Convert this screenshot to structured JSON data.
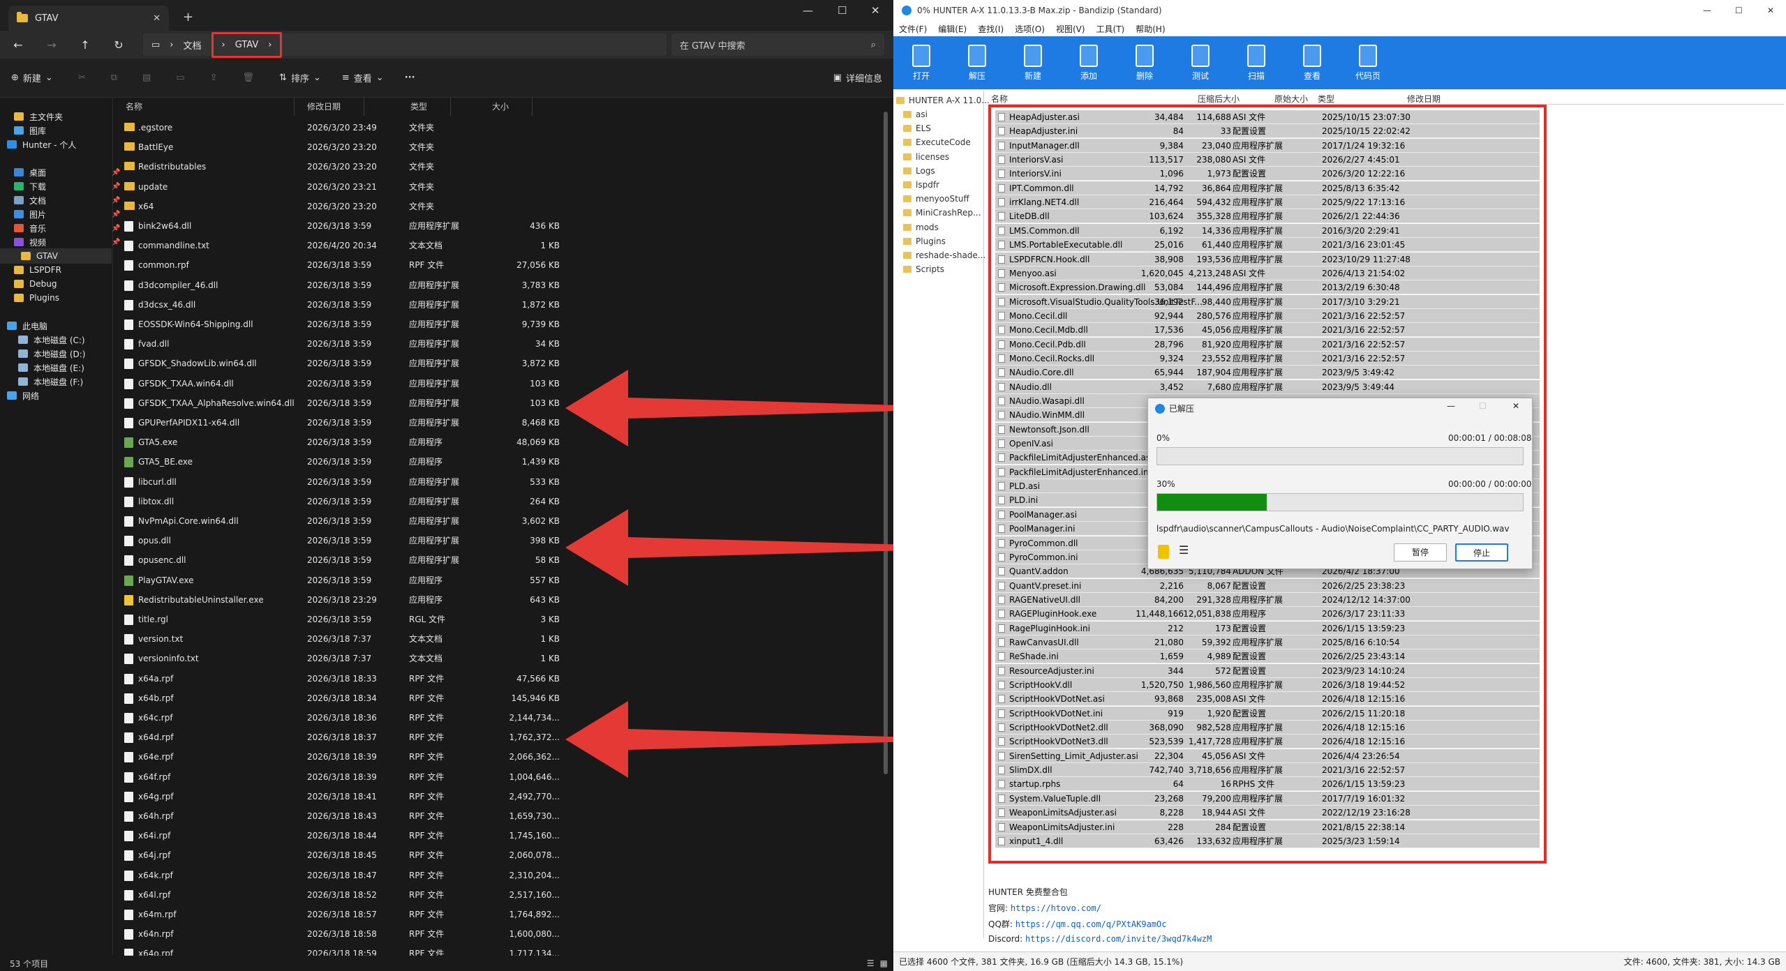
{
  "explorer": {
    "tab_title": "GTAV",
    "path": [
      "文档",
      "GTAV"
    ],
    "search_placeholder": "在 GTAV 中搜索",
    "toolbar": {
      "new": "新建",
      "sort": "排序",
      "view": "查看",
      "more": "···",
      "details": "详细信息"
    },
    "columns": {
      "name": "名称",
      "date": "修改日期",
      "type": "类型",
      "size": "大小"
    },
    "sidebar": [
      {
        "label": "主文件夹",
        "icon": "home-icon",
        "color": "#e8b93a"
      },
      {
        "label": "图库",
        "icon": "gallery-icon",
        "color": "#4aa3e8"
      },
      {
        "label": "Hunter - 个人",
        "icon": "cloud-icon",
        "color": "#2d8fe5"
      },
      {
        "label": "桌面",
        "icon": "desktop-icon",
        "color": "#3d86d6"
      },
      {
        "label": "下载",
        "icon": "download-icon",
        "color": "#2db36d"
      },
      {
        "label": "文档",
        "icon": "documents-icon",
        "color": "#7ea0c4"
      },
      {
        "label": "图片",
        "icon": "pictures-icon",
        "color": "#3c8fe0"
      },
      {
        "label": "音乐",
        "icon": "music-icon",
        "color": "#e2553e"
      },
      {
        "label": "视频",
        "icon": "videos-icon",
        "color": "#8a53d6"
      },
      {
        "label": "GTAV",
        "icon": "folder-icon",
        "color": "#e8b93a"
      },
      {
        "label": "LSPDFR",
        "icon": "folder-icon",
        "color": "#e8b93a"
      },
      {
        "label": "Debug",
        "icon": "folder-icon",
        "color": "#e8b93a"
      },
      {
        "label": "Plugins",
        "icon": "folder-icon",
        "color": "#e8b93a"
      },
      {
        "label": "此电脑",
        "icon": "pc-icon",
        "color": "#4aa3e8"
      },
      {
        "label": "本地磁盘 (C:)",
        "icon": "drive-icon",
        "color": "#8fb4d8"
      },
      {
        "label": "本地磁盘 (D:)",
        "icon": "drive-icon",
        "color": "#8fb4d8"
      },
      {
        "label": "本地磁盘 (E:)",
        "icon": "drive-icon",
        "color": "#8fb4d8"
      },
      {
        "label": "本地磁盘 (F:)",
        "icon": "drive-icon",
        "color": "#8fb4d8"
      },
      {
        "label": "网络",
        "icon": "network-icon",
        "color": "#4aa3e8"
      }
    ],
    "files": [
      {
        "name": ".egstore",
        "date": "2026/3/20 23:49",
        "type": "文件夹",
        "size": "",
        "kind": "folder"
      },
      {
        "name": "BattlEye",
        "date": "2026/3/20 23:20",
        "type": "文件夹",
        "size": "",
        "kind": "folder"
      },
      {
        "name": "Redistributables",
        "date": "2026/3/20 23:20",
        "type": "文件夹",
        "size": "",
        "kind": "folder"
      },
      {
        "name": "update",
        "date": "2026/3/20 23:21",
        "type": "文件夹",
        "size": "",
        "kind": "folder"
      },
      {
        "name": "x64",
        "date": "2026/3/20 23:20",
        "type": "文件夹",
        "size": "",
        "kind": "folder"
      },
      {
        "name": "bink2w64.dll",
        "date": "2026/3/18 3:59",
        "type": "应用程序扩展",
        "size": "436 KB",
        "kind": "file"
      },
      {
        "name": "commandline.txt",
        "date": "2026/4/20 20:34",
        "type": "文本文档",
        "size": "1 KB",
        "kind": "file"
      },
      {
        "name": "common.rpf",
        "date": "2026/3/18 3:59",
        "type": "RPF 文件",
        "size": "27,056 KB",
        "kind": "file"
      },
      {
        "name": "d3dcompiler_46.dll",
        "date": "2026/3/18 3:59",
        "type": "应用程序扩展",
        "size": "3,783 KB",
        "kind": "file"
      },
      {
        "name": "d3dcsx_46.dll",
        "date": "2026/3/18 3:59",
        "type": "应用程序扩展",
        "size": "1,872 KB",
        "kind": "file"
      },
      {
        "name": "EOSSDK-Win64-Shipping.dll",
        "date": "2026/3/18 3:59",
        "type": "应用程序扩展",
        "size": "9,739 KB",
        "kind": "file"
      },
      {
        "name": "fvad.dll",
        "date": "2026/3/18 3:59",
        "type": "应用程序扩展",
        "size": "34 KB",
        "kind": "file"
      },
      {
        "name": "GFSDK_ShadowLib.win64.dll",
        "date": "2026/3/18 3:59",
        "type": "应用程序扩展",
        "size": "3,872 KB",
        "kind": "file"
      },
      {
        "name": "GFSDK_TXAA.win64.dll",
        "date": "2026/3/18 3:59",
        "type": "应用程序扩展",
        "size": "103 KB",
        "kind": "file"
      },
      {
        "name": "GFSDK_TXAA_AlphaResolve.win64.dll",
        "date": "2026/3/18 3:59",
        "type": "应用程序扩展",
        "size": "103 KB",
        "kind": "file"
      },
      {
        "name": "GPUPerfAPIDX11-x64.dll",
        "date": "2026/3/18 3:59",
        "type": "应用程序扩展",
        "size": "8,468 KB",
        "kind": "file"
      },
      {
        "name": "GTA5.exe",
        "date": "2026/3/18 3:59",
        "type": "应用程序",
        "size": "48,069 KB",
        "kind": "exe"
      },
      {
        "name": "GTA5_BE.exe",
        "date": "2026/3/18 3:59",
        "type": "应用程序",
        "size": "1,439 KB",
        "kind": "exe"
      },
      {
        "name": "libcurl.dll",
        "date": "2026/3/18 3:59",
        "type": "应用程序扩展",
        "size": "533 KB",
        "kind": "file"
      },
      {
        "name": "libtox.dll",
        "date": "2026/3/18 3:59",
        "type": "应用程序扩展",
        "size": "264 KB",
        "kind": "file"
      },
      {
        "name": "NvPmApi.Core.win64.dll",
        "date": "2026/3/18 3:59",
        "type": "应用程序扩展",
        "size": "3,602 KB",
        "kind": "file"
      },
      {
        "name": "opus.dll",
        "date": "2026/3/18 3:59",
        "type": "应用程序扩展",
        "size": "398 KB",
        "kind": "file"
      },
      {
        "name": "opusenc.dll",
        "date": "2026/3/18 3:59",
        "type": "应用程序扩展",
        "size": "58 KB",
        "kind": "file"
      },
      {
        "name": "PlayGTAV.exe",
        "date": "2026/3/18 3:59",
        "type": "应用程序",
        "size": "557 KB",
        "kind": "exe"
      },
      {
        "name": "RedistributableUninstaller.exe",
        "date": "2026/3/18 23:29",
        "type": "应用程序",
        "size": "643 KB",
        "kind": "exe2"
      },
      {
        "name": "title.rgl",
        "date": "2026/3/18 3:59",
        "type": "RGL 文件",
        "size": "3 KB",
        "kind": "file"
      },
      {
        "name": "version.txt",
        "date": "2026/3/18 7:37",
        "type": "文本文档",
        "size": "1 KB",
        "kind": "file"
      },
      {
        "name": "versioninfo.txt",
        "date": "2026/3/18 7:37",
        "type": "文本文档",
        "size": "1 KB",
        "kind": "file"
      },
      {
        "name": "x64a.rpf",
        "date": "2026/3/18 18:33",
        "type": "RPF 文件",
        "size": "47,566 KB",
        "kind": "file"
      },
      {
        "name": "x64b.rpf",
        "date": "2026/3/18 18:34",
        "type": "RPF 文件",
        "size": "145,946 KB",
        "kind": "file"
      },
      {
        "name": "x64c.rpf",
        "date": "2026/3/18 18:36",
        "type": "RPF 文件",
        "size": "2,144,734...",
        "kind": "file"
      },
      {
        "name": "x64d.rpf",
        "date": "2026/3/18 18:37",
        "type": "RPF 文件",
        "size": "1,762,372...",
        "kind": "file"
      },
      {
        "name": "x64e.rpf",
        "date": "2026/3/18 18:39",
        "type": "RPF 文件",
        "size": "2,066,362...",
        "kind": "file"
      },
      {
        "name": "x64f.rpf",
        "date": "2026/3/18 18:39",
        "type": "RPF 文件",
        "size": "1,004,646...",
        "kind": "file"
      },
      {
        "name": "x64g.rpf",
        "date": "2026/3/18 18:41",
        "type": "RPF 文件",
        "size": "2,492,770...",
        "kind": "file"
      },
      {
        "name": "x64h.rpf",
        "date": "2026/3/18 18:43",
        "type": "RPF 文件",
        "size": "1,659,730...",
        "kind": "file"
      },
      {
        "name": "x64i.rpf",
        "date": "2026/3/18 18:44",
        "type": "RPF 文件",
        "size": "1,745,160...",
        "kind": "file"
      },
      {
        "name": "x64j.rpf",
        "date": "2026/3/18 18:45",
        "type": "RPF 文件",
        "size": "2,060,078...",
        "kind": "file"
      },
      {
        "name": "x64k.rpf",
        "date": "2026/3/18 18:47",
        "type": "RPF 文件",
        "size": "2,310,204...",
        "kind": "file"
      },
      {
        "name": "x64l.rpf",
        "date": "2026/3/18 18:52",
        "type": "RPF 文件",
        "size": "2,517,160...",
        "kind": "file"
      },
      {
        "name": "x64m.rpf",
        "date": "2026/3/18 18:57",
        "type": "RPF 文件",
        "size": "1,764,892...",
        "kind": "file"
      },
      {
        "name": "x64n.rpf",
        "date": "2026/3/18 18:58",
        "type": "RPF 文件",
        "size": "1,600,080...",
        "kind": "file"
      },
      {
        "name": "x64o.rpf",
        "date": "2026/3/18 18:59",
        "type": "RPF 文件",
        "size": "1,717,134...",
        "kind": "file"
      }
    ],
    "status": "53 个项目"
  },
  "bandizip": {
    "title": "0% HUNTER A-X 11.0.13.3-B Max.zip - Bandizip (Standard)",
    "menu": [
      "文件(F)",
      "编辑(E)",
      "查找(I)",
      "选项(O)",
      "视图(V)",
      "工具(T)",
      "帮助(H)"
    ],
    "toolbar": [
      {
        "label": "打开",
        "icon": "open-icon"
      },
      {
        "label": "解压",
        "icon": "extract-icon"
      },
      {
        "label": "新建",
        "icon": "new-archive-icon"
      },
      {
        "label": "添加",
        "icon": "add-icon"
      },
      {
        "label": "删除",
        "icon": "delete-icon"
      },
      {
        "label": "测试",
        "icon": "test-icon"
      },
      {
        "label": "扫描",
        "icon": "scan-icon"
      },
      {
        "label": "查看",
        "icon": "view-icon"
      },
      {
        "label": "代码页",
        "icon": "codepage-icon"
      }
    ],
    "tree_root": "HUNTER A-X 11.0...",
    "tree": [
      "asi",
      "ELS",
      "ExecuteCode",
      "licenses",
      "Logs",
      "lspdfr",
      "menyooStuff",
      "MiniCrashRep...",
      "mods",
      "Plugins",
      "reshade-shade...",
      "Scripts"
    ],
    "columns": {
      "name": "名称",
      "packed": "压缩后大小",
      "original": "原始大小",
      "type": "类型",
      "date": "修改日期"
    },
    "files": [
      [
        "HeapAdjuster.asi",
        "34,484",
        "114,688",
        "ASI 文件",
        "2025/10/15 23:07:30"
      ],
      [
        "HeapAdjuster.ini",
        "84",
        "33",
        "配置设置",
        "2025/10/15 22:02:42"
      ],
      [
        "InputManager.dll",
        "9,384",
        "23,040",
        "应用程序扩展",
        "2017/1/24 19:32:16"
      ],
      [
        "InteriorsV.asi",
        "113,517",
        "238,080",
        "ASI 文件",
        "2026/2/27 4:45:01"
      ],
      [
        "InteriorsV.ini",
        "1,096",
        "1,973",
        "配置设置",
        "2026/3/20 12:22:16"
      ],
      [
        "IPT.Common.dll",
        "14,792",
        "36,864",
        "应用程序扩展",
        "2025/8/13 6:35:42"
      ],
      [
        "irrKlang.NET4.dll",
        "216,464",
        "594,432",
        "应用程序扩展",
        "2025/9/22 17:13:16"
      ],
      [
        "LiteDB.dll",
        "103,624",
        "355,328",
        "应用程序扩展",
        "2026/2/1 22:44:36"
      ],
      [
        "LMS.Common.dll",
        "6,192",
        "14,336",
        "应用程序扩展",
        "2016/3/20 2:29:41"
      ],
      [
        "LMS.PortableExecutable.dll",
        "25,016",
        "61,440",
        "应用程序扩展",
        "2021/3/16 23:01:45"
      ],
      [
        "LSPDFRCN.Hook.dll",
        "38,908",
        "193,536",
        "应用程序扩展",
        "2023/10/29 11:27:48"
      ],
      [
        "Menyoo.asi",
        "1,620,045",
        "4,213,248",
        "ASI 文件",
        "2026/4/13 21:54:02"
      ],
      [
        "Microsoft.Expression.Drawing.dll",
        "53,084",
        "144,496",
        "应用程序扩展",
        "2013/2/19 6:30:48"
      ],
      [
        "Microsoft.VisualStudio.QualityTools.UnitTestF...",
        "36,192",
        "98,440",
        "应用程序扩展",
        "2017/3/10 3:29:21"
      ],
      [
        "Mono.Cecil.dll",
        "92,944",
        "280,576",
        "应用程序扩展",
        "2021/3/16 22:52:57"
      ],
      [
        "Mono.Cecil.Mdb.dll",
        "17,536",
        "45,056",
        "应用程序扩展",
        "2021/3/16 22:52:57"
      ],
      [
        "Mono.Cecil.Pdb.dll",
        "28,796",
        "81,920",
        "应用程序扩展",
        "2021/3/16 22:52:57"
      ],
      [
        "Mono.Cecil.Rocks.dll",
        "9,324",
        "23,552",
        "应用程序扩展",
        "2021/3/16 22:52:57"
      ],
      [
        "NAudio.Core.dll",
        "65,944",
        "187,904",
        "应用程序扩展",
        "2023/9/5 3:49:42"
      ],
      [
        "NAudio.dll",
        "3,452",
        "7,680",
        "应用程序扩展",
        "2023/9/5 3:49:44"
      ],
      [
        "NAudio.Wasapi.dll",
        "",
        "",
        "",
        ""
      ],
      [
        "NAudio.WinMM.dll",
        "",
        "",
        "",
        ""
      ],
      [
        "Newtonsoft.Json.dll",
        "",
        "",
        "",
        ""
      ],
      [
        "OpenIV.asi",
        "",
        "",
        "",
        ""
      ],
      [
        "PackfileLimitAdjusterEnhanced.asi",
        "",
        "",
        "",
        ""
      ],
      [
        "PackfileLimitAdjusterEnhanced.ini",
        "",
        "",
        "",
        ""
      ],
      [
        "PLD.asi",
        "",
        "",
        "",
        ""
      ],
      [
        "PLD.ini",
        "",
        "",
        "",
        ""
      ],
      [
        "PoolManager.asi",
        "",
        "",
        "",
        ""
      ],
      [
        "PoolManager.ini",
        "",
        "",
        "",
        ""
      ],
      [
        "PyroCommon.dll",
        "",
        "",
        "",
        ""
      ],
      [
        "PyroCommon.ini",
        "",
        "",
        "",
        ""
      ],
      [
        "QuantV.addon",
        "4,686,635",
        "5,110,784",
        "ADDON 文件",
        "2026/4/2 18:37:00"
      ],
      [
        "QuantV.preset.ini",
        "2,216",
        "8,067",
        "配置设置",
        "2026/2/25 23:38:23"
      ],
      [
        "RAGENativeUI.dll",
        "84,200",
        "291,328",
        "应用程序扩展",
        "2024/12/12 14:37:00"
      ],
      [
        "RAGEPluginHook.exe",
        "11,448,166",
        "12,051,838",
        "应用程序",
        "2026/3/17 23:11:33"
      ],
      [
        "RagePluginHook.ini",
        "212",
        "173",
        "配置设置",
        "2026/1/15 13:59:23"
      ],
      [
        "RawCanvasUI.dll",
        "21,080",
        "59,392",
        "应用程序扩展",
        "2025/8/16 6:10:54"
      ],
      [
        "ReShade.ini",
        "1,659",
        "4,989",
        "配置设置",
        "2026/2/25 23:43:14"
      ],
      [
        "ResourceAdjuster.ini",
        "344",
        "572",
        "配置设置",
        "2023/9/23 14:10:24"
      ],
      [
        "ScriptHookV.dll",
        "1,520,750",
        "1,986,560",
        "应用程序扩展",
        "2026/3/18 19:44:52"
      ],
      [
        "ScriptHookVDotNet.asi",
        "93,868",
        "235,008",
        "ASI 文件",
        "2026/4/18 12:15:16"
      ],
      [
        "ScriptHookVDotNet.ini",
        "919",
        "1,920",
        "配置设置",
        "2026/2/15 11:20:18"
      ],
      [
        "ScriptHookVDotNet2.dll",
        "368,090",
        "982,528",
        "应用程序扩展",
        "2026/4/18 12:15:16"
      ],
      [
        "ScriptHookVDotNet3.dll",
        "523,539",
        "1,417,728",
        "应用程序扩展",
        "2026/4/18 12:15:16"
      ],
      [
        "SirenSetting_Limit_Adjuster.asi",
        "22,304",
        "45,056",
        "ASI 文件",
        "2026/4/4 23:26:54"
      ],
      [
        "SlimDX.dll",
        "742,740",
        "3,718,656",
        "应用程序扩展",
        "2021/3/16 22:52:57"
      ],
      [
        "startup.rphs",
        "64",
        "16",
        "RPHS 文件",
        "2026/1/15 13:59:23"
      ],
      [
        "System.ValueTuple.dll",
        "23,268",
        "79,200",
        "应用程序扩展",
        "2017/7/19 16:01:32"
      ],
      [
        "WeaponLimitsAdjuster.asi",
        "8,228",
        "18,944",
        "ASI 文件",
        "2022/12/19 23:16:28"
      ],
      [
        "WeaponLimitsAdjuster.ini",
        "228",
        "284",
        "配置设置",
        "2021/8/15 22:38:14"
      ],
      [
        "xinput1_4.dll",
        "63,426",
        "133,632",
        "应用程序扩展",
        "2025/3/23 1:59:14"
      ]
    ],
    "info": {
      "name": "HUNTER 免费整合包",
      "site_label": "官网:",
      "site": "https://htovo.com/",
      "qq_label": "QQ群:",
      "qq": "https://qm.qq.com/q/PXtAK9amOc",
      "discord_label": "Discord:",
      "discord": "https://discord.com/invite/3wqd7k4wzM"
    },
    "status_left": "已选择 4600 个文件, 381 文件夹, 16.9 GB (压缩后大小 14.3 GB, 15.1%)",
    "status_right": "文件: 4600, 文件夹: 381, 大小: 14.3 GB"
  },
  "dialog": {
    "title": "已解压",
    "total_pct": "0%",
    "total_time": "00:00:01 / 00:08:08",
    "total_progress": 0.0,
    "file_pct": "30%",
    "file_time": "00:00:00 / 00:00:00",
    "file_progress": 0.3,
    "current": "lspdfr\\audio\\scanner\\CampusCallouts - Audio\\NoiseComplaint\\CC_PARTY_AUDIO.wav",
    "pause": "暂停",
    "stop": "停止"
  },
  "colors": {
    "highlight_red": "#e52a2a",
    "progress_green": "#118e11",
    "bandizip_blue": "#1e7be3"
  }
}
